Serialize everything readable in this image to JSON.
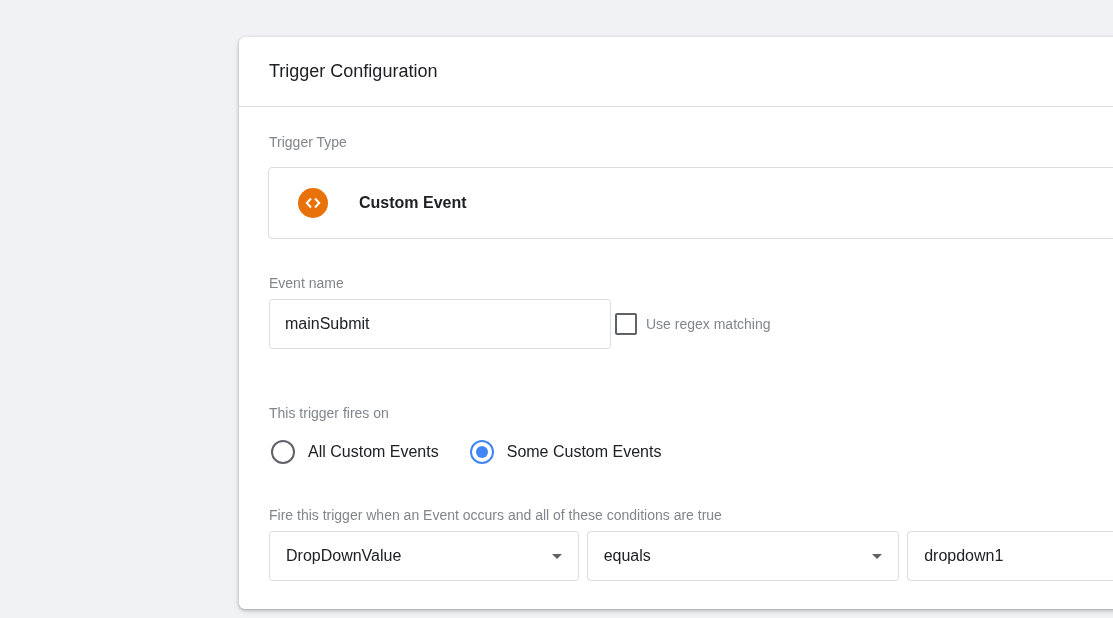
{
  "dialog": {
    "title": "Trigger Configuration"
  },
  "trigger_type": {
    "label": "Trigger Type",
    "name": "Custom Event"
  },
  "event_name": {
    "label": "Event name",
    "value": "mainSubmit",
    "regex": {
      "label": "Use regex matching",
      "checked": false
    }
  },
  "fires_on": {
    "label": "This trigger fires on",
    "options": [
      {
        "label": "All Custom Events",
        "selected": false
      },
      {
        "label": "Some Custom Events",
        "selected": true
      }
    ]
  },
  "conditions": {
    "label": "Fire this trigger when an Event occurs and all of these conditions are true",
    "fields": [
      {
        "kind": "dropdown",
        "value": "DropDownValue"
      },
      {
        "kind": "dropdown",
        "value": "equals"
      },
      {
        "kind": "text",
        "value": "dropdown1"
      }
    ]
  }
}
